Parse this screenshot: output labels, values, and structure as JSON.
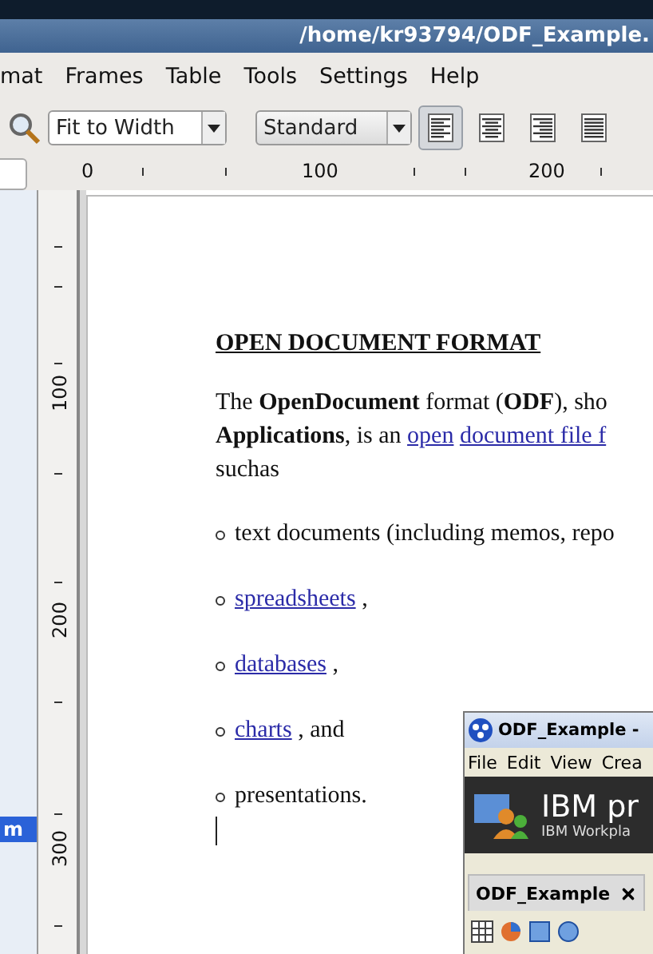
{
  "window": {
    "title": "/home/kr93794/ODF_Example."
  },
  "menu": [
    "mat",
    "Frames",
    "Table",
    "Tools",
    "Settings",
    "Help"
  ],
  "toolbar": {
    "zoom": "Fit to Width",
    "style": "Standard",
    "align": [
      {
        "kind": "left",
        "selected": true
      },
      {
        "kind": "center",
        "selected": false
      },
      {
        "kind": "right",
        "selected": false
      },
      {
        "kind": "justify",
        "selected": false
      }
    ]
  },
  "ruler": {
    "horizontal": [
      "0",
      "100",
      "200"
    ],
    "vertical": [
      "100",
      "200",
      "300"
    ]
  },
  "side_panel": {
    "label": "m"
  },
  "document": {
    "heading": "OPEN DOCUMENT FORMAT",
    "paragraph": [
      [
        {
          "kind": "text",
          "text": "The **OpenDocument** format (**ODF**), sho"
        }
      ],
      [
        {
          "kind": "text",
          "text": "**Applications**, is an "
        },
        {
          "kind": "link",
          "text": "open"
        },
        {
          "kind": "link",
          "text": "document file f"
        }
      ],
      [
        {
          "kind": "text",
          "text": "suchas"
        }
      ]
    ],
    "bullets": [
      [
        {
          "kind": "text",
          "text": "text documents (including memos, repo"
        }
      ],
      [
        {
          "kind": "link",
          "text": "spreadsheets"
        },
        {
          "kind": "text",
          "text": " ,"
        }
      ],
      [
        {
          "kind": "link",
          "text": "databases"
        },
        {
          "kind": "text",
          "text": " ,"
        }
      ],
      [
        {
          "kind": "link",
          "text": "charts"
        },
        {
          "kind": "text",
          "text": " , and"
        }
      ],
      [
        {
          "kind": "text",
          "text": "presentations."
        }
      ]
    ]
  },
  "overlay_window": {
    "title": "ODF_Example -",
    "menu": [
      "File",
      "Edit",
      "View",
      "Crea"
    ],
    "banner_title": "IBM pr",
    "banner_subtitle": "IBM Workpla",
    "tab": "ODF_Example"
  }
}
